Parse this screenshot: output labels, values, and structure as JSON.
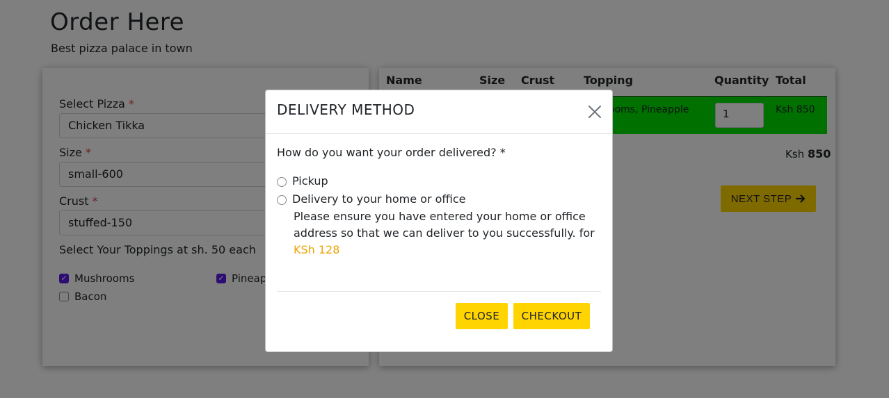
{
  "header": {
    "title": "Order Here",
    "subtitle": "Best pizza palace in town"
  },
  "order_form": {
    "pizza_label": "Select Pizza",
    "pizza_value": "Chicken Tikka",
    "size_label": "Size",
    "size_value": "small-600",
    "crust_label": "Crust",
    "crust_value": "stuffed-150",
    "required_mark": "*",
    "toppings_label": "Select Your Toppings at sh. 50 each",
    "toppings": [
      {
        "label": "Mushrooms",
        "checked": true
      },
      {
        "label": "Pineapple",
        "checked": true
      },
      {
        "label": "Bacon",
        "checked": false
      }
    ]
  },
  "order_table": {
    "headers": [
      "Name",
      "Size",
      "Crust",
      "Topping",
      "Quantity",
      "Total"
    ],
    "row": {
      "topping": "ooms, Pineapple",
      "quantity": "1",
      "total": "Ksh 850"
    },
    "grand_total_currency": "Ksh",
    "grand_total_value": "850",
    "next_step_label": "NEXT STEP",
    "row_color": "#00e000"
  },
  "modal": {
    "title": "DELIVERY METHOD",
    "question": "How do you want your order delivered? *",
    "options": [
      {
        "label": "Pickup",
        "selected": false
      },
      {
        "label": "Delivery to your home or office",
        "selected": false
      }
    ],
    "note": "Please ensure you have entered your home or office address so that we can deliver to you successfully. for",
    "fee": "KSh 128",
    "close_label": "CLOSE",
    "checkout_label": "CHECKOUT",
    "close_icon": "close-icon"
  },
  "colors": {
    "accent": "#ffd400",
    "checkbox": "#5a1ae6",
    "fee": "#f0a400"
  }
}
